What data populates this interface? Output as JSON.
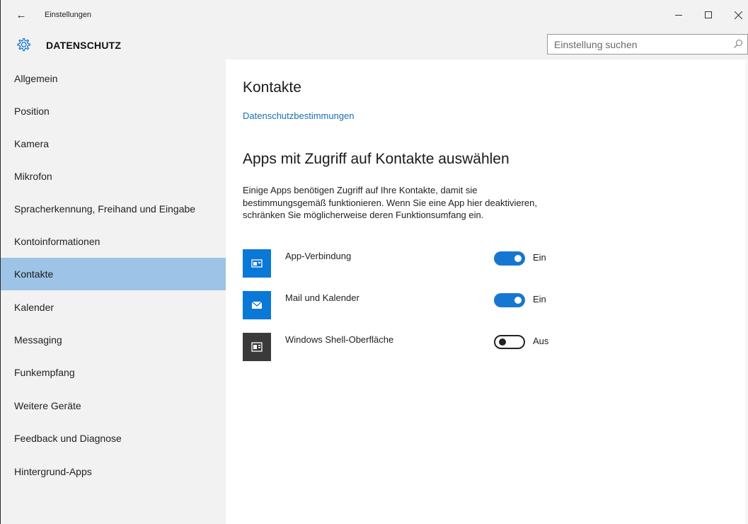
{
  "window": {
    "title": "Einstellungen"
  },
  "header": {
    "section_title": "DATENSCHUTZ",
    "search_placeholder": "Einstellung suchen"
  },
  "sidebar": {
    "items": [
      {
        "label": "Allgemein",
        "active": false
      },
      {
        "label": "Position",
        "active": false
      },
      {
        "label": "Kamera",
        "active": false
      },
      {
        "label": "Mikrofon",
        "active": false
      },
      {
        "label": "Spracherkennung, Freihand und Eingabe",
        "active": false
      },
      {
        "label": "Kontoinformationen",
        "active": false
      },
      {
        "label": "Kontakte",
        "active": true
      },
      {
        "label": "Kalender",
        "active": false
      },
      {
        "label": "Messaging",
        "active": false
      },
      {
        "label": "Funkempfang",
        "active": false
      },
      {
        "label": "Weitere Geräte",
        "active": false
      },
      {
        "label": "Feedback und Diagnose",
        "active": false
      },
      {
        "label": "Hintergrund-Apps",
        "active": false
      }
    ]
  },
  "main": {
    "title": "Kontakte",
    "privacy_link": "Datenschutzbestimmungen",
    "subheading": "Apps mit Zugriff auf Kontakte auswählen",
    "description": "Einige Apps benötigen Zugriff auf Ihre Kontakte, damit sie bestimmungsgemäß funktionieren. Wenn Sie eine App hier deaktivieren, schränken Sie möglicherweise deren Funktionsumfang ein.",
    "apps": [
      {
        "name": "App-Verbindung",
        "state": "Ein",
        "on": true,
        "icon": "app-connector-icon",
        "icon_bg": "#0a78d7"
      },
      {
        "name": "Mail und Kalender",
        "state": "Ein",
        "on": true,
        "icon": "mail-icon",
        "icon_bg": "#0a78d7"
      },
      {
        "name": "Windows Shell-Oberfläche",
        "state": "Aus",
        "on": false,
        "icon": "shell-icon",
        "icon_bg": "#3a3a3a"
      }
    ]
  },
  "colors": {
    "accent": "#1677d2",
    "link": "#1a6fb4",
    "active_nav": "#9dc3e6",
    "chrome_bg": "#f2f2f2"
  }
}
